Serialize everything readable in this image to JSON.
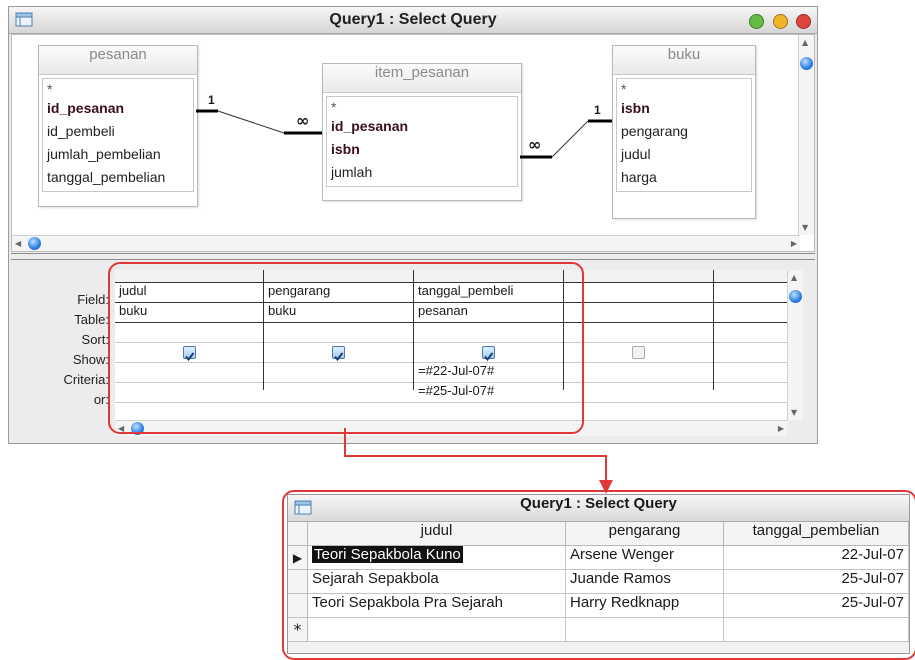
{
  "design_window": {
    "title": "Query1 : Select Query",
    "tables": [
      {
        "name": "pesanan",
        "fields": [
          "*",
          "id_pesanan",
          "id_pembeli",
          "jumlah_pembelian",
          "tanggal_pembelian"
        ],
        "key_fields": [
          "id_pesanan"
        ]
      },
      {
        "name": "item_pesanan",
        "fields": [
          "*",
          "id_pesanan",
          "isbn",
          "jumlah"
        ],
        "key_fields": [
          "id_pesanan",
          "isbn"
        ]
      },
      {
        "name": "buku",
        "fields": [
          "*",
          "isbn",
          "pengarang",
          "judul",
          "harga"
        ],
        "key_fields": [
          "isbn"
        ]
      }
    ],
    "relations": [
      {
        "from": "pesanan",
        "to": "item_pesanan",
        "one_label": "1",
        "many_label": "∞"
      },
      {
        "from": "buku",
        "to": "item_pesanan",
        "one_label": "1",
        "many_label": "∞"
      }
    ],
    "grid": {
      "row_labels": [
        "Field:",
        "Table:",
        "Sort:",
        "Show:",
        "Criteria:",
        "or:"
      ],
      "columns": [
        {
          "field": "judul",
          "table": "buku",
          "sort": "",
          "show": true,
          "criteria": "",
          "or": ""
        },
        {
          "field": "pengarang",
          "table": "buku",
          "sort": "",
          "show": true,
          "criteria": "",
          "or": ""
        },
        {
          "field": "tanggal_pembeli",
          "table": "pesanan",
          "sort": "",
          "show": true,
          "criteria": "=#22-Jul-07#",
          "or": "=#25-Jul-07#"
        },
        {
          "field": "",
          "table": "",
          "sort": "",
          "show": false,
          "criteria": "",
          "or": ""
        }
      ]
    }
  },
  "result_window": {
    "title": "Query1 : Select Query",
    "headers": [
      "judul",
      "pengarang",
      "tanggal_pembelian"
    ],
    "rows": [
      [
        "Teori Sepakbola Kuno",
        "Arsene Wenger",
        "22-Jul-07"
      ],
      [
        "Sejarah Sepakbola",
        "Juande Ramos",
        "25-Jul-07"
      ],
      [
        "Teori Sepakbola Pra Sejarah",
        "Harry Redknapp",
        "25-Jul-07"
      ]
    ],
    "new_row_marker": "*",
    "current_row_marker": "▶"
  },
  "colors": {
    "annotation": "#e03838",
    "close": "#e0453c",
    "minimize": "#f0b429",
    "zoom": "#66bb44",
    "scroll_knob": "#2a7de1"
  }
}
